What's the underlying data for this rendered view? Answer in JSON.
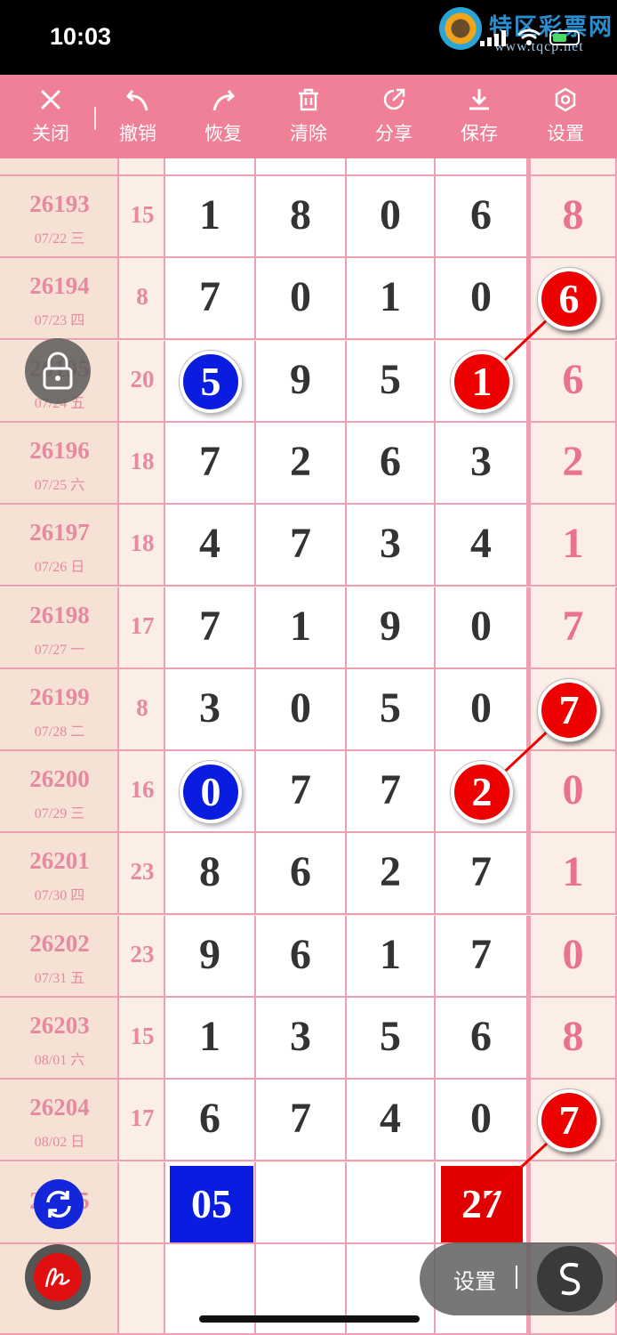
{
  "status_bar": {
    "time": "10:03"
  },
  "watermark": {
    "text": "特区彩票网",
    "url": "www.tqcp.net"
  },
  "toolbar": {
    "items": [
      {
        "label": "关闭",
        "icon": "close-icon"
      },
      {
        "label": "撤销",
        "icon": "undo-icon"
      },
      {
        "label": "恢复",
        "icon": "redo-icon"
      },
      {
        "label": "清除",
        "icon": "trash-icon"
      },
      {
        "label": "分享",
        "icon": "share-icon"
      },
      {
        "label": "保存",
        "icon": "download-icon"
      },
      {
        "label": "设置",
        "icon": "gear-icon"
      }
    ]
  },
  "rows": [
    {
      "period": "26193",
      "date": "07/22 三",
      "sum": "15",
      "d": [
        "1",
        "8",
        "0",
        "6"
      ],
      "last": "8"
    },
    {
      "period": "26194",
      "date": "07/23 四",
      "sum": "8",
      "d": [
        "7",
        "0",
        "1",
        "0"
      ],
      "last": "6"
    },
    {
      "period": "26195",
      "date": "07/24 五",
      "sum": "20",
      "d": [
        "5",
        "9",
        "5",
        "1"
      ],
      "last": "6"
    },
    {
      "period": "26196",
      "date": "07/25 六",
      "sum": "18",
      "d": [
        "7",
        "2",
        "6",
        "3"
      ],
      "last": "2"
    },
    {
      "period": "26197",
      "date": "07/26 日",
      "sum": "18",
      "d": [
        "4",
        "7",
        "3",
        "4"
      ],
      "last": "1"
    },
    {
      "period": "26198",
      "date": "07/27 一",
      "sum": "17",
      "d": [
        "7",
        "1",
        "9",
        "0"
      ],
      "last": "7"
    },
    {
      "period": "26199",
      "date": "07/28 二",
      "sum": "8",
      "d": [
        "3",
        "0",
        "5",
        "0"
      ],
      "last": "7"
    },
    {
      "period": "26200",
      "date": "07/29 三",
      "sum": "16",
      "d": [
        "0",
        "7",
        "7",
        "2"
      ],
      "last": "0"
    },
    {
      "period": "26201",
      "date": "07/30 四",
      "sum": "23",
      "d": [
        "8",
        "6",
        "2",
        "7"
      ],
      "last": "1"
    },
    {
      "period": "26202",
      "date": "07/31 五",
      "sum": "23",
      "d": [
        "9",
        "6",
        "1",
        "7"
      ],
      "last": "0"
    },
    {
      "period": "26203",
      "date": "08/01 六",
      "sum": "15",
      "d": [
        "1",
        "3",
        "5",
        "6"
      ],
      "last": "8"
    },
    {
      "period": "26204",
      "date": "08/02 日",
      "sum": "17",
      "d": [
        "6",
        "7",
        "4",
        "0"
      ],
      "last": "7"
    }
  ],
  "next_period": {
    "period": "26205",
    "blue_box": "05",
    "red_box": "27"
  },
  "highlights": {
    "red": [
      {
        "row": 1,
        "col": 4
      },
      {
        "row": 2,
        "col": 3
      },
      {
        "row": 6,
        "col": 4
      },
      {
        "row": 7,
        "col": 3
      },
      {
        "row": 11,
        "col": 4
      }
    ],
    "blue": [
      {
        "row": 2,
        "col": 0
      },
      {
        "row": 7,
        "col": 0
      }
    ],
    "colors": {
      "red": "#e00000",
      "blue": "#0a1ce0",
      "toolbar": "#f08097"
    }
  },
  "settings_pill": {
    "label": "设置"
  }
}
